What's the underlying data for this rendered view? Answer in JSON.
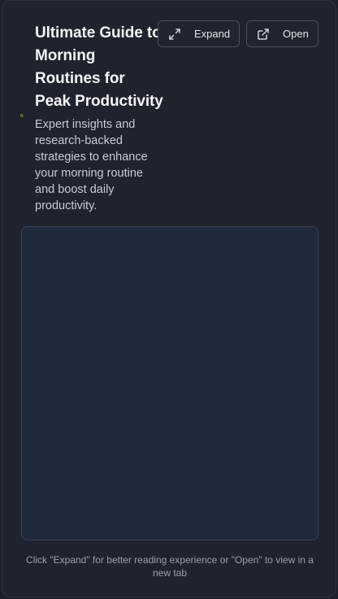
{
  "header": {
    "title": "Ultimate Guide to Morning Routines for Peak Productivity",
    "description": "Expert insights and research-backed strategies to enhance your morning routine and boost daily productivity."
  },
  "actions": {
    "expand_label": "Expand",
    "open_label": "Open"
  },
  "icons": {
    "expand": "expand-arrows-icon",
    "open": "external-link-icon",
    "favicon": "favicon-icon"
  },
  "footer": {
    "hint": "Click \"Expand\" for better reading experience or \"Open\" to view in a new tab"
  },
  "colors": {
    "background": "#1e232d",
    "frame": "#1e293b",
    "favicon": "#d4a72c"
  }
}
